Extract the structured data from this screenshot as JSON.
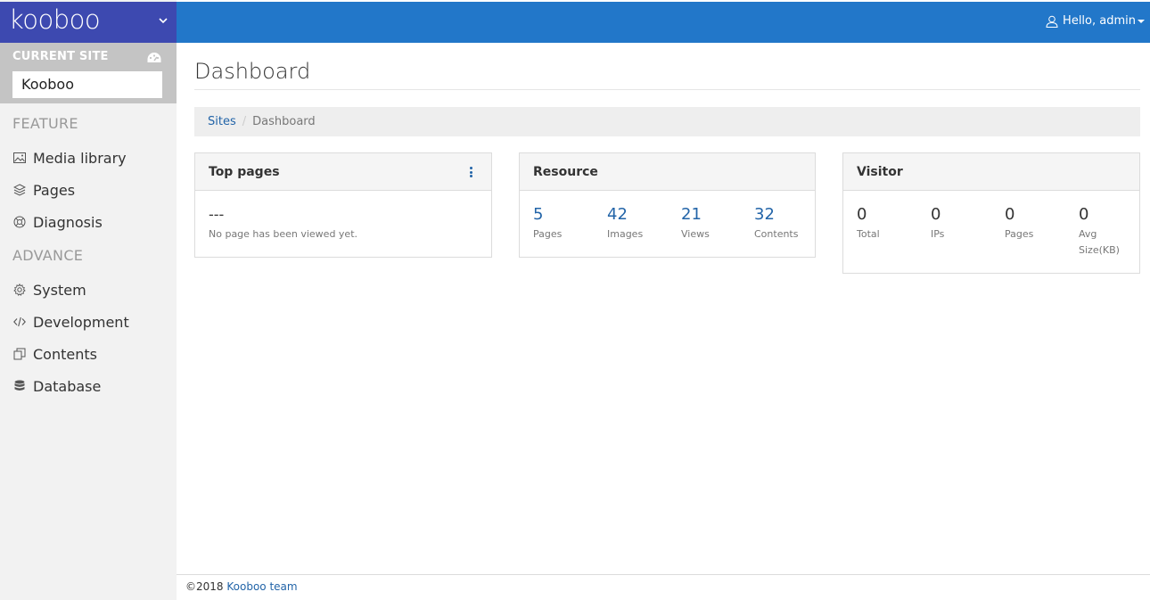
{
  "brand": {
    "name": "kooboo"
  },
  "site": {
    "label": "CURRENT SITE",
    "value": "Kooboo"
  },
  "sidebar": {
    "feature_title": "FEATURE",
    "feature_items": [
      {
        "label": "Media library",
        "icon": "image-icon"
      },
      {
        "label": "Pages",
        "icon": "layers-icon"
      },
      {
        "label": "Diagnosis",
        "icon": "lifebuoy-icon"
      }
    ],
    "advance_title": "ADVANCE",
    "advance_items": [
      {
        "label": "System",
        "icon": "gear-icon"
      },
      {
        "label": "Development",
        "icon": "code-icon"
      },
      {
        "label": "Contents",
        "icon": "copy-icon"
      },
      {
        "label": "Database",
        "icon": "database-icon"
      }
    ]
  },
  "topbar": {
    "user_greeting": "Hello, admin"
  },
  "page": {
    "title": "Dashboard"
  },
  "breadcrumb": {
    "root": "Sites",
    "current": "Dashboard"
  },
  "panels": {
    "top_pages": {
      "title": "Top pages",
      "value": "---",
      "message": "No page has been viewed yet."
    },
    "resource": {
      "title": "Resource",
      "stats": [
        {
          "value": "5",
          "label": "Pages"
        },
        {
          "value": "42",
          "label": "Images"
        },
        {
          "value": "21",
          "label": "Views"
        },
        {
          "value": "32",
          "label": "Contents"
        }
      ]
    },
    "visitor": {
      "title": "Visitor",
      "stats": [
        {
          "value": "0",
          "label": "Total"
        },
        {
          "value": "0",
          "label": "IPs"
        },
        {
          "value": "0",
          "label": "Pages"
        },
        {
          "value": "0",
          "label": "Avg Size(KB)"
        }
      ]
    }
  },
  "footer": {
    "copyright": "©2018",
    "link_text": "Kooboo team"
  },
  "colors": {
    "brand": "#3d49b0",
    "topbar": "#2277c9",
    "link": "#2264a8"
  }
}
